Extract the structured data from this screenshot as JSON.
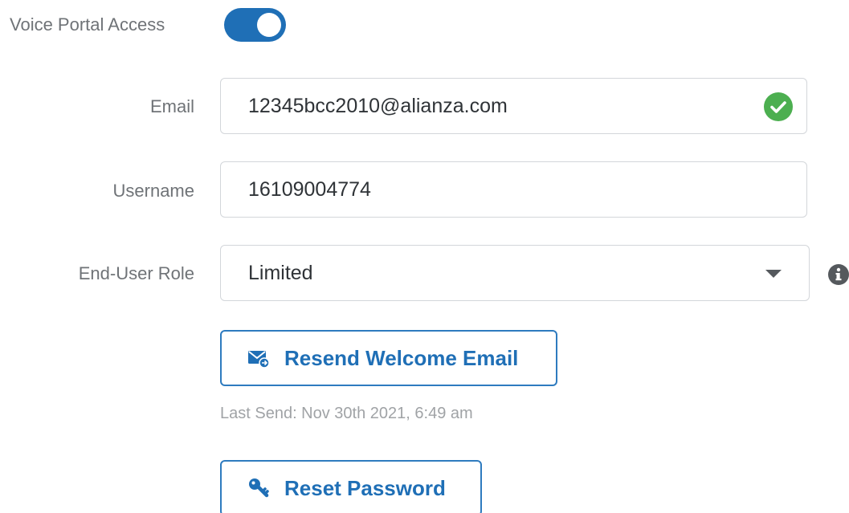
{
  "voice_portal": {
    "label": "Voice Portal Access",
    "enabled": true
  },
  "form": {
    "email": {
      "label": "Email",
      "value": "12345bcc2010@alianza.com",
      "valid_icon": "check-circle-icon"
    },
    "username": {
      "label": "Username",
      "value": "16109004774"
    },
    "role": {
      "label": "End-User Role",
      "selected": "Limited",
      "info_icon": "info-circle-icon"
    }
  },
  "actions": {
    "resend_label": "Resend Welcome Email",
    "resend_icon": "mail-forward-icon",
    "last_send": "Last Send: Nov 30th 2021, 6:49 am",
    "reset_label": "Reset Password",
    "reset_icon": "key-icon"
  },
  "colors": {
    "accent": "#1f6fb6",
    "success": "#4caf50",
    "label": "#6f7377",
    "muted": "#a0a3a6"
  }
}
